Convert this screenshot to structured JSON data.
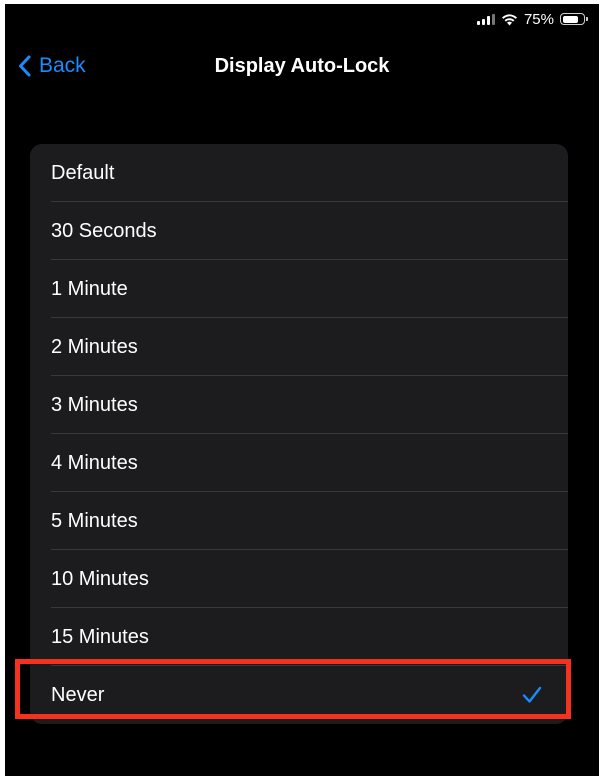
{
  "status_bar": {
    "battery_percent": "75%",
    "battery_level": 0.75
  },
  "nav": {
    "back_label": "Back",
    "title": "Display Auto-Lock"
  },
  "options": [
    {
      "label": "Default",
      "selected": false
    },
    {
      "label": "30 Seconds",
      "selected": false
    },
    {
      "label": "1 Minute",
      "selected": false
    },
    {
      "label": "2 Minutes",
      "selected": false
    },
    {
      "label": "3 Minutes",
      "selected": false
    },
    {
      "label": "4 Minutes",
      "selected": false
    },
    {
      "label": "5 Minutes",
      "selected": false
    },
    {
      "label": "10 Minutes",
      "selected": false
    },
    {
      "label": "15 Minutes",
      "selected": false
    },
    {
      "label": "Never",
      "selected": true
    }
  ],
  "icons": {
    "back": "chevron-left-icon",
    "selected": "checkmark-icon",
    "signal": "cellular-signal-icon",
    "wifi": "wifi-icon",
    "battery": "battery-icon"
  },
  "colors": {
    "accent": "#1a8cff",
    "highlight": "#f5311f",
    "background": "#000000",
    "group_background": "#1c1c1e"
  }
}
